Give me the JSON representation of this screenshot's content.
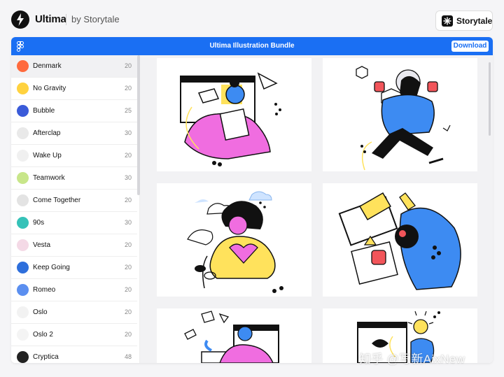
{
  "header": {
    "brand": "Ultima",
    "byline": "by Storytale",
    "storytale_button": "Storytale"
  },
  "topbar": {
    "title": "Ultima Illustration Bundle",
    "download_label": "Download"
  },
  "sidebar": {
    "items": [
      {
        "label": "Denmark",
        "count": "20",
        "color": "#ff6a3d"
      },
      {
        "label": "No Gravity",
        "count": "20",
        "color": "#ffd23f"
      },
      {
        "label": "Bubble",
        "count": "25",
        "color": "#3a5bd9"
      },
      {
        "label": "Afterclap",
        "count": "30",
        "color": "#e9e9e9"
      },
      {
        "label": "Wake Up",
        "count": "20",
        "color": "#f0f0f0"
      },
      {
        "label": "Teamwork",
        "count": "30",
        "color": "#c8e68a"
      },
      {
        "label": "Come Together",
        "count": "20",
        "color": "#e3e3e3"
      },
      {
        "label": "90s",
        "count": "30",
        "color": "#35c2b8"
      },
      {
        "label": "Vesta",
        "count": "20",
        "color": "#f4d9e6"
      },
      {
        "label": "Keep Going",
        "count": "20",
        "color": "#2e6fdc"
      },
      {
        "label": "Romeo",
        "count": "20",
        "color": "#5b8ff0"
      },
      {
        "label": "Oslo",
        "count": "20",
        "color": "#f2f2f2"
      },
      {
        "label": "Oslo 2",
        "count": "20",
        "color": "#f4f4f4"
      },
      {
        "label": "Cryptica",
        "count": "48",
        "color": "#222222"
      }
    ]
  },
  "colors": {
    "accent": "#1a6ff3",
    "pink": "#f06de0",
    "blue": "#3d8bf2",
    "yellow": "#ffe25c",
    "red": "#f2555a"
  },
  "watermark": "知乎 @写新AixNew"
}
